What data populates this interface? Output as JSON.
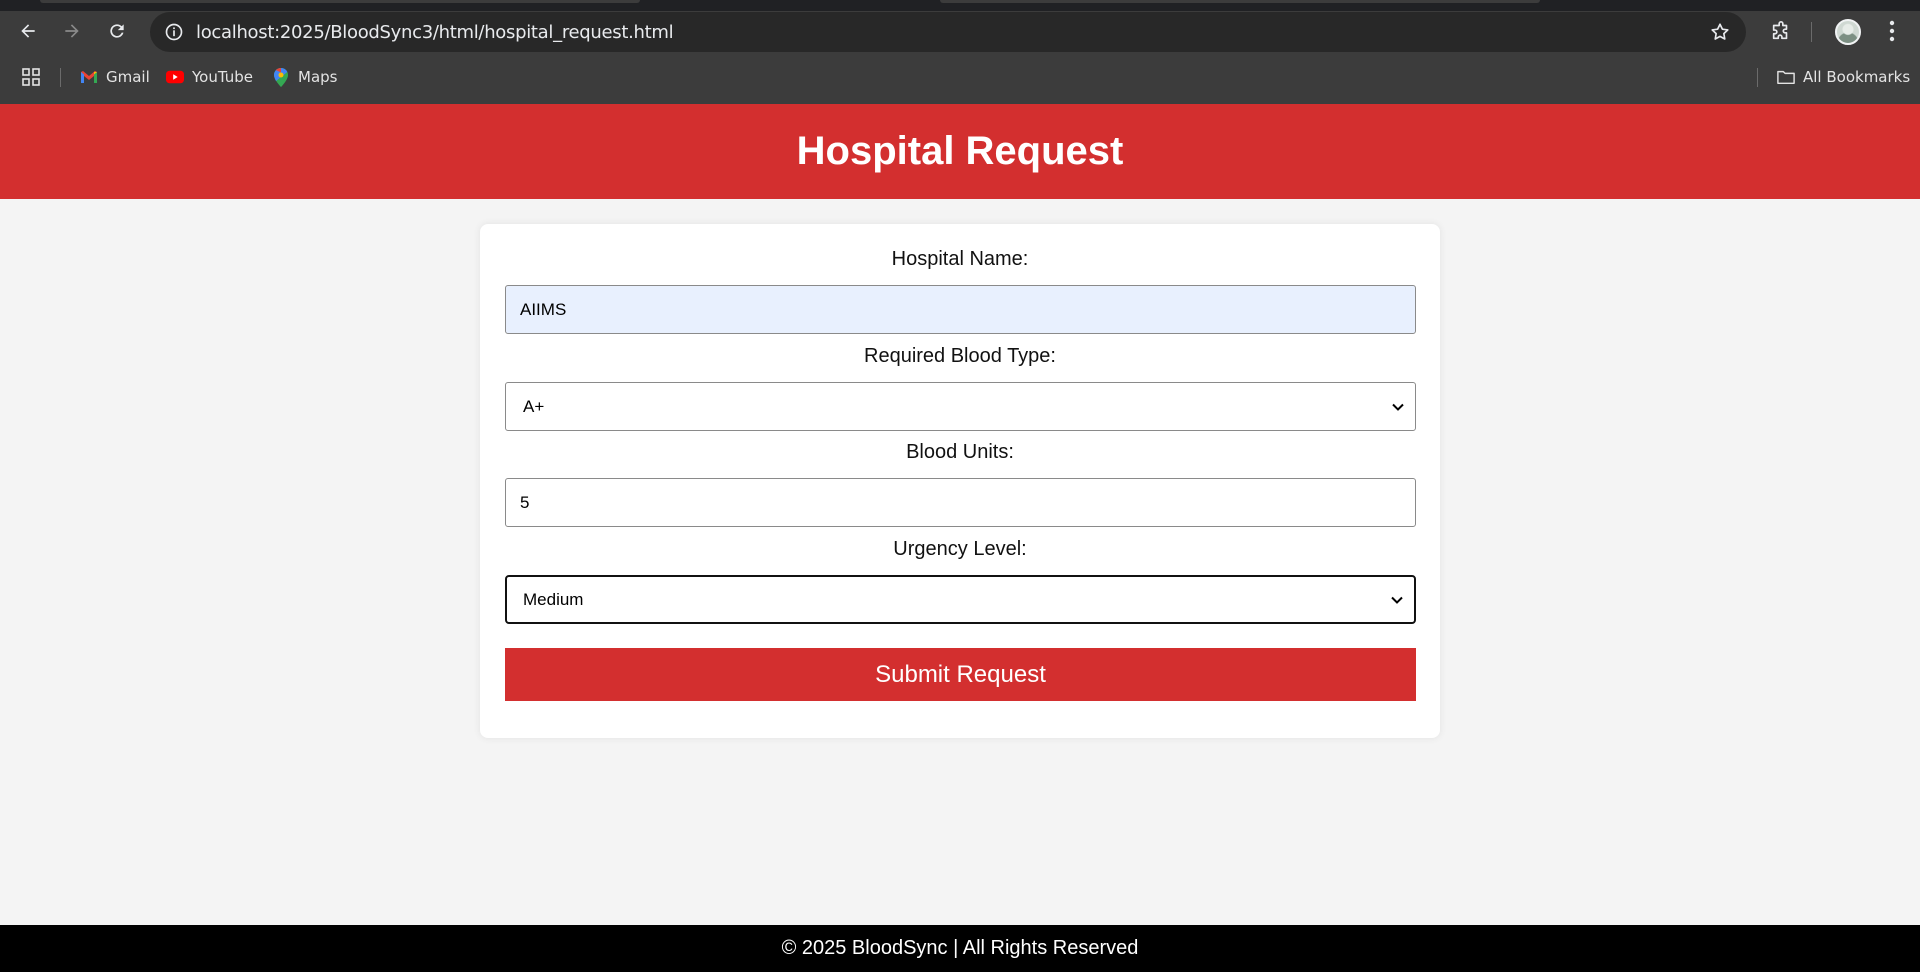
{
  "browser": {
    "url": "localhost:2025/BloodSync3/html/hospital_request.html",
    "bookmarks": [
      {
        "label": "Gmail",
        "icon": "gmail-icon"
      },
      {
        "label": "YouTube",
        "icon": "youtube-icon"
      },
      {
        "label": "Maps",
        "icon": "maps-icon"
      }
    ],
    "all_bookmarks_label": "All Bookmarks"
  },
  "header": {
    "title": "Hospital Request"
  },
  "form": {
    "hospital_name_label": "Hospital Name:",
    "hospital_name_value": "AIIMS",
    "blood_type_label": "Required Blood Type:",
    "blood_type_value": "A+",
    "blood_units_label": "Blood Units:",
    "blood_units_value": "5",
    "urgency_label": "Urgency Level:",
    "urgency_value": "Medium",
    "submit_label": "Submit Request"
  },
  "footer": {
    "text": "© 2025 BloodSync | All Rights Reserved"
  },
  "colors": {
    "brand_red": "#d32f2f",
    "page_bg": "#f4f4f4",
    "autofill_bg": "#e8f0fe",
    "footer_bg": "#000000"
  }
}
